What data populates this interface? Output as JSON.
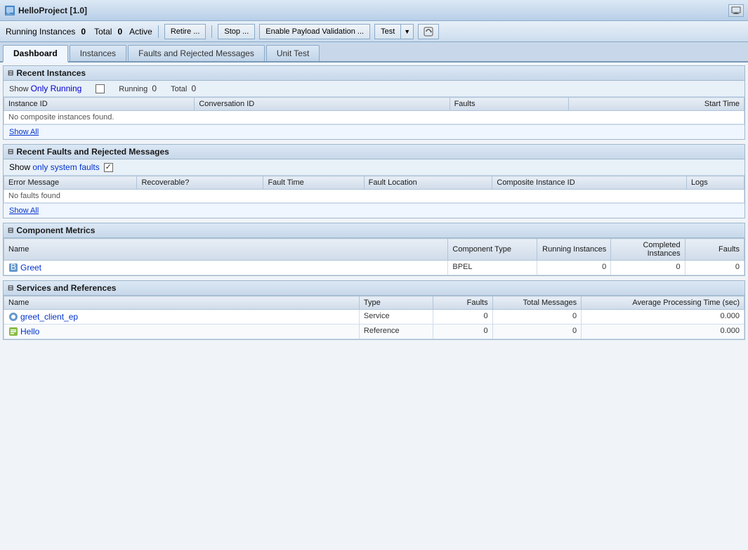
{
  "titleBar": {
    "title": "HelloProject [1.0]",
    "actionIcon": "monitor-icon"
  },
  "toolbar": {
    "runningInstances": {
      "label": "Running Instances",
      "count": "0"
    },
    "total": {
      "label": "Total",
      "count": "0"
    },
    "activeLabel": "Active",
    "retireBtn": "Retire ...",
    "stopBtn": "Stop ...",
    "enablePayloadBtn": "Enable Payload Validation ...",
    "testBtn": "Test",
    "refreshBtn": "↻"
  },
  "tabs": [
    {
      "id": "dashboard",
      "label": "Dashboard",
      "active": true
    },
    {
      "id": "instances",
      "label": "Instances",
      "active": false
    },
    {
      "id": "faults",
      "label": "Faults and Rejected Messages",
      "active": false
    },
    {
      "id": "unittest",
      "label": "Unit Test",
      "active": false
    }
  ],
  "sections": {
    "recentInstances": {
      "title": "Recent Instances",
      "showOnlyRunning": "Show Only Running",
      "runningLabel": "Running",
      "runningCount": "0",
      "totalLabel": "Total",
      "totalCount": "0",
      "columns": [
        "Instance ID",
        "Conversation ID",
        "Faults",
        "Start Time"
      ],
      "noDataMessage": "No composite instances found.",
      "showAllLabel": "Show All"
    },
    "recentFaults": {
      "title": "Recent Faults and Rejected Messages",
      "showOnlySystemFaults": "Show",
      "onlyText": "only system faults",
      "checked": true,
      "columns": [
        "Error Message",
        "Recoverable?",
        "Fault Time",
        "Fault Location",
        "Composite Instance ID",
        "Logs"
      ],
      "noDataMessage": "No faults found",
      "showAllLabel": "Show All"
    },
    "componentMetrics": {
      "title": "Component Metrics",
      "columns": [
        "Name",
        "Component Type",
        "Running Instances",
        "Completed Instances",
        "Faults"
      ],
      "rows": [
        {
          "name": "Greet",
          "type": "BPEL",
          "running": "0",
          "completed": "0",
          "faults": "0"
        }
      ]
    },
    "servicesAndReferences": {
      "title": "Services and References",
      "columns": [
        "Name",
        "Type",
        "Faults",
        "Total Messages",
        "Average Processing Time (sec)"
      ],
      "rows": [
        {
          "name": "greet_client_ep",
          "type": "Service",
          "faults": "0",
          "totalMessages": "0",
          "avgTime": "0.000"
        },
        {
          "name": "Hello",
          "type": "Reference",
          "faults": "0",
          "totalMessages": "0",
          "avgTime": "0.000"
        }
      ]
    }
  }
}
